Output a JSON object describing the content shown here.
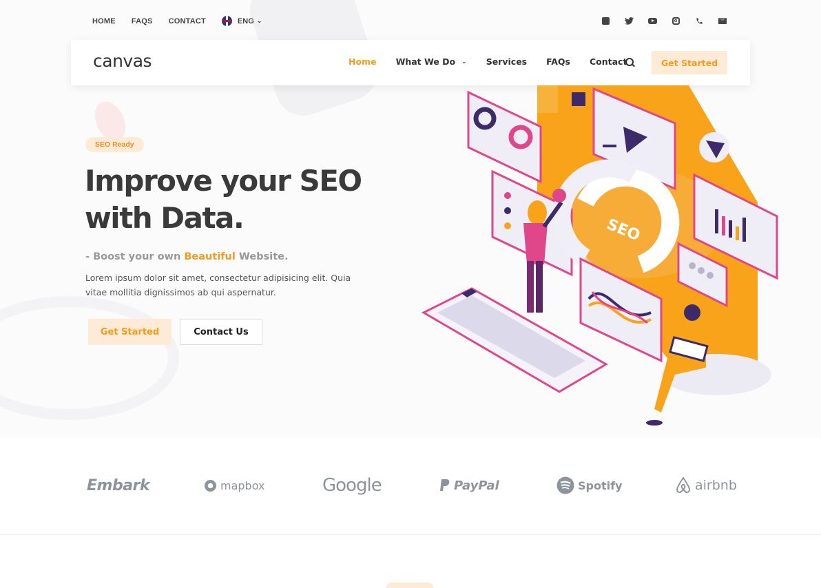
{
  "topbar": {
    "links": [
      "HOME",
      "FAQS",
      "CONTACT"
    ],
    "language": "ENG",
    "social_icons": [
      "facebook-icon",
      "twitter-icon",
      "youtube-icon",
      "instagram-icon",
      "phone-icon",
      "envelope-icon"
    ]
  },
  "header": {
    "logo": "canvas",
    "nav": [
      {
        "label": "Home",
        "active": true
      },
      {
        "label": "What We Do",
        "dropdown": true
      },
      {
        "label": "Services"
      },
      {
        "label": "FAQs"
      },
      {
        "label": "Contact"
      }
    ],
    "cta": "Get Started"
  },
  "hero": {
    "badge": "SEO Ready",
    "title_line1": "Improve your SEO",
    "title_line2": "with Data.",
    "tagline_prefix": "- Boost your own",
    "tagline_highlight": "Beautiful",
    "tagline_suffix": "Website.",
    "description": "Lorem ipsum dolor sit amet, consectetur adipisicing elit. Quia vitae mollitia dignissimos ab qui aspernatur.",
    "primary_button": "Get Started",
    "secondary_button": "Contact Us",
    "illustration_text": "SEO"
  },
  "brands": [
    "Embark",
    "mapbox",
    "Google",
    "PayPal",
    "Spotify",
    "airbnb"
  ],
  "colors": {
    "accent": "#f39c1c",
    "accent_light": "#fdebd8",
    "text_dark": "#3a3a3a",
    "illustration_purple": "#3d2a6b",
    "illustration_pink": "#e0478a"
  }
}
